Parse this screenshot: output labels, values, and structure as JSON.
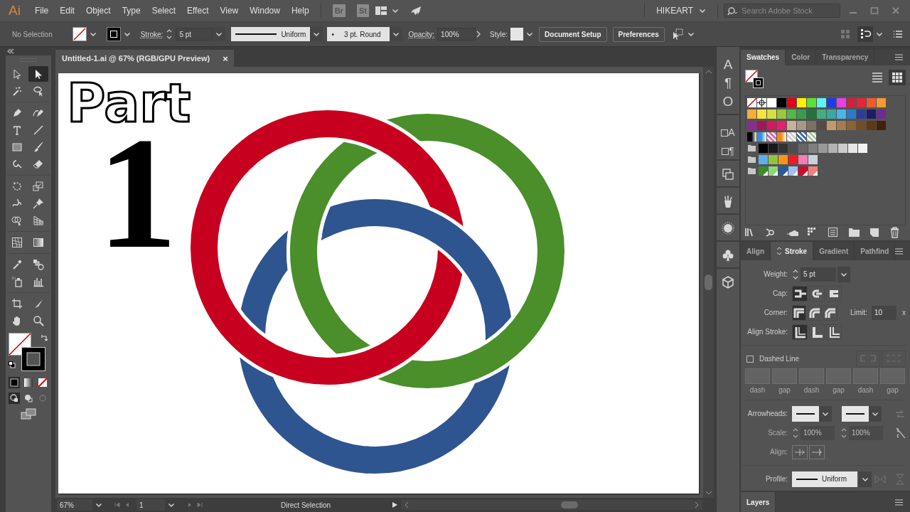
{
  "app": {
    "logo": "Ai"
  },
  "menu": [
    "File",
    "Edit",
    "Object",
    "Type",
    "Select",
    "Effect",
    "View",
    "Window",
    "Help"
  ],
  "bridge": "Br",
  "stock": "St",
  "workspace": "HIKEART",
  "search": {
    "placeholder": "Search Adobe Stock"
  },
  "control_bar": {
    "selection": "No Selection",
    "stroke_label": "Stroke:",
    "stroke_weight": "5 pt",
    "variable_width": "Uniform",
    "brush_dot": "•",
    "brush": "3 pt. Round",
    "opacity_label": "Opacity:",
    "opacity": "100%",
    "style_label": "Style:",
    "buttons": [
      "Document Setup",
      "Preferences"
    ]
  },
  "tools": [
    {
      "kind": "selection",
      "selected": false
    },
    {
      "kind": "direct-selection",
      "selected": true
    },
    {
      "kind": "magic-wand",
      "selected": false
    },
    {
      "kind": "lasso",
      "selected": false
    },
    {
      "kind": "pen",
      "selected": false
    },
    {
      "kind": "curvature",
      "selected": false
    },
    {
      "kind": "type",
      "selected": false
    },
    {
      "kind": "line",
      "selected": false
    },
    {
      "kind": "rectangle",
      "selected": false
    },
    {
      "kind": "paintbrush",
      "selected": false
    },
    {
      "kind": "shaper",
      "selected": false
    },
    {
      "kind": "eraser",
      "selected": false
    },
    {
      "kind": "rotate",
      "selected": false
    },
    {
      "kind": "scale",
      "selected": false
    },
    {
      "kind": "warp",
      "selected": false
    },
    {
      "kind": "pin",
      "selected": false
    },
    {
      "kind": "shape-builder",
      "selected": false
    },
    {
      "kind": "perspective-grid",
      "selected": false
    },
    {
      "kind": "mesh",
      "selected": false
    },
    {
      "kind": "gradient",
      "selected": false
    },
    {
      "kind": "eyedropper",
      "selected": false
    },
    {
      "kind": "blend",
      "selected": false
    },
    {
      "kind": "symbol-sprayer",
      "selected": false
    },
    {
      "kind": "graph",
      "selected": false
    },
    {
      "kind": "artboard",
      "selected": false
    },
    {
      "kind": "slice",
      "selected": false
    },
    {
      "kind": "hand",
      "selected": false
    },
    {
      "kind": "zoom",
      "selected": false
    }
  ],
  "document": {
    "title": "Untitled-1.ai @ 67% (RGB/GPU Preview)",
    "close": "×"
  },
  "artboard": {
    "texts": [
      {
        "kind": "outline",
        "text": "Part"
      },
      {
        "kind": "numeral",
        "text": "1"
      }
    ]
  },
  "status_bar": {
    "zoom": "67%",
    "artboard": "1",
    "tool": "Direct Selection"
  },
  "panel_icons": [
    {
      "kind": "glyph",
      "text": "A"
    },
    {
      "kind": "glyph",
      "text": "¶"
    },
    {
      "kind": "glyph",
      "text": "O"
    },
    {
      "kind": "styles",
      "text": "A"
    },
    {
      "kind": "styles",
      "text": "¶"
    },
    {
      "kind": "transform"
    },
    {
      "kind": "brushes"
    },
    {
      "kind": "appearance"
    },
    {
      "kind": "symbols"
    },
    {
      "kind": "libraries"
    }
  ],
  "swatches_panel": {
    "tabs": [
      {
        "label": "Swatches",
        "selected": true
      },
      {
        "label": "Color",
        "selected": false
      },
      {
        "label": "Transparency",
        "selected": false
      }
    ],
    "views": [
      {
        "kind": "list",
        "selected": false
      },
      {
        "kind": "grid",
        "selected": true
      }
    ],
    "rows": [
      {
        "folder": false,
        "swatches": [
          {
            "kind": "none"
          },
          {
            "kind": "registration"
          },
          {
            "kind": "color",
            "color": "#ffffff"
          },
          {
            "kind": "color",
            "color": "#000000"
          },
          {
            "kind": "color",
            "color": "#e2001a"
          },
          {
            "kind": "color",
            "color": "#fff200"
          },
          {
            "kind": "color",
            "color": "#5ce135"
          },
          {
            "kind": "color",
            "color": "#5ff3f3"
          },
          {
            "kind": "color",
            "color": "#1c3ce8"
          },
          {
            "kind": "color",
            "color": "#e83ee8"
          },
          {
            "kind": "color",
            "color": "#c8243a"
          },
          {
            "kind": "color",
            "color": "#e2263b"
          },
          {
            "kind": "color",
            "color": "#ee5a2f"
          },
          {
            "kind": "color",
            "color": "#f39a33"
          }
        ]
      },
      {
        "folder": false,
        "swatches": [
          {
            "kind": "color",
            "color": "#f4ad3a"
          },
          {
            "kind": "color",
            "color": "#f6e43e"
          },
          {
            "kind": "color",
            "color": "#d9e03b"
          },
          {
            "kind": "color",
            "color": "#9bc83d"
          },
          {
            "kind": "color",
            "color": "#53b848"
          },
          {
            "kind": "color",
            "color": "#3a9c4b"
          },
          {
            "kind": "color",
            "color": "#23733c"
          },
          {
            "kind": "color",
            "color": "#3fb07f"
          },
          {
            "kind": "color",
            "color": "#35aba3"
          },
          {
            "kind": "color",
            "color": "#4eb3e5"
          },
          {
            "kind": "color",
            "color": "#2c7bc7"
          },
          {
            "kind": "color",
            "color": "#2d3e97"
          },
          {
            "kind": "color",
            "color": "#1d1c66"
          },
          {
            "kind": "color",
            "color": "#6a2d8f"
          }
        ]
      },
      {
        "folder": false,
        "swatches": [
          {
            "kind": "color",
            "color": "#8e2b8e"
          },
          {
            "kind": "color",
            "color": "#a3155e"
          },
          {
            "kind": "color",
            "color": "#d3185d"
          },
          {
            "kind": "color",
            "color": "#e2206f"
          },
          {
            "kind": "color",
            "color": "#c7b29b"
          },
          {
            "kind": "color",
            "color": "#a89886"
          },
          {
            "kind": "color",
            "color": "#7d7065"
          },
          {
            "kind": "color",
            "color": "#574c45"
          },
          {
            "kind": "color",
            "color": "#c39a6b"
          },
          {
            "kind": "color",
            "color": "#a67b4d"
          },
          {
            "kind": "color",
            "color": "#8c6239"
          },
          {
            "kind": "color",
            "color": "#754c24"
          },
          {
            "kind": "color",
            "color": "#603812"
          },
          {
            "kind": "color",
            "color": "#42210b"
          }
        ]
      },
      {
        "folder": false,
        "swatches": [
          {
            "kind": "gradient",
            "color": "#000000"
          },
          {
            "kind": "gradient",
            "color": "#3a8fd8"
          },
          {
            "kind": "pattern",
            "color": "#e06aa8"
          },
          {
            "kind": "gradient",
            "color": "#f08a1a"
          },
          {
            "kind": "pattern",
            "color": "#cfcfcf"
          },
          {
            "kind": "pattern",
            "color": "#3a6fa8"
          },
          {
            "kind": "pattern",
            "color": "#a8c8a0"
          }
        ]
      },
      {
        "folder": true,
        "swatches": [
          {
            "kind": "color",
            "color": "#000000"
          },
          {
            "kind": "color",
            "color": "#1a1a1a"
          },
          {
            "kind": "color",
            "color": "#333333"
          },
          {
            "kind": "color",
            "color": "#4d4d4d"
          },
          {
            "kind": "color",
            "color": "#666666"
          },
          {
            "kind": "color",
            "color": "#808080"
          },
          {
            "kind": "color",
            "color": "#999999"
          },
          {
            "kind": "color",
            "color": "#b3b3b3"
          },
          {
            "kind": "color",
            "color": "#cccccc"
          },
          {
            "kind": "color",
            "color": "#e6e6e6"
          },
          {
            "kind": "color",
            "color": "#f2f2f2"
          }
        ]
      },
      {
        "folder": true,
        "swatches": [
          {
            "kind": "color",
            "color": "#5eaee8"
          },
          {
            "kind": "color",
            "color": "#8dc63f"
          },
          {
            "kind": "color",
            "color": "#f7941d"
          },
          {
            "kind": "color",
            "color": "#ed1c24"
          },
          {
            "kind": "color",
            "color": "#f27eb2"
          },
          {
            "kind": "color",
            "color": "#c9d1dc"
          }
        ]
      },
      {
        "folder": true,
        "swatches": [
          {
            "kind": "global",
            "color": "#3e8a2a"
          },
          {
            "kind": "global",
            "color": "#8fd67a"
          },
          {
            "kind": "global",
            "color": "#2a5a9a"
          },
          {
            "kind": "global",
            "color": "#9ec1f0"
          },
          {
            "kind": "global",
            "color": "#c8102e"
          },
          {
            "kind": "global",
            "color": "#f08080"
          }
        ]
      }
    ]
  },
  "stroke_panel": {
    "tabs": [
      {
        "label": "Align",
        "selected": false
      },
      {
        "label": "Stroke",
        "selected": true
      },
      {
        "label": "Gradient",
        "selected": false
      },
      {
        "label": "Pathfind",
        "selected": false
      }
    ],
    "weight": {
      "label": "Weight:",
      "value": "5 pt"
    },
    "cap": {
      "label": "Cap:",
      "options": [
        {
          "kind": "butt",
          "selected": true
        },
        {
          "kind": "round",
          "selected": false
        },
        {
          "kind": "square",
          "selected": false
        }
      ]
    },
    "corner": {
      "label": "Corner:",
      "options": [
        {
          "kind": "miter",
          "selected": true
        },
        {
          "kind": "round",
          "selected": false
        },
        {
          "kind": "bevel",
          "selected": false
        }
      ],
      "limit_label": "Limit:",
      "limit": "10",
      "limit_unit": "x"
    },
    "align_stroke": {
      "label": "Align Stroke:",
      "options": [
        {
          "kind": "center",
          "selected": true
        },
        {
          "kind": "inside",
          "selected": false
        },
        {
          "kind": "outside",
          "selected": false
        }
      ]
    },
    "dashed": {
      "label": "Dashed Line",
      "checked": false,
      "fields": [
        "dash",
        "gap",
        "dash",
        "gap",
        "dash",
        "gap"
      ]
    },
    "arrowheads": {
      "label": "Arrowheads:"
    },
    "scale": {
      "label": "Scale:",
      "values": [
        "100%",
        "100%"
      ],
      "disabled": true
    },
    "align": {
      "label": "Align:",
      "disabled": true
    },
    "profile": {
      "label": "Profile:",
      "value": "Uniform"
    }
  },
  "layers_panel": {
    "title": "Layers"
  }
}
